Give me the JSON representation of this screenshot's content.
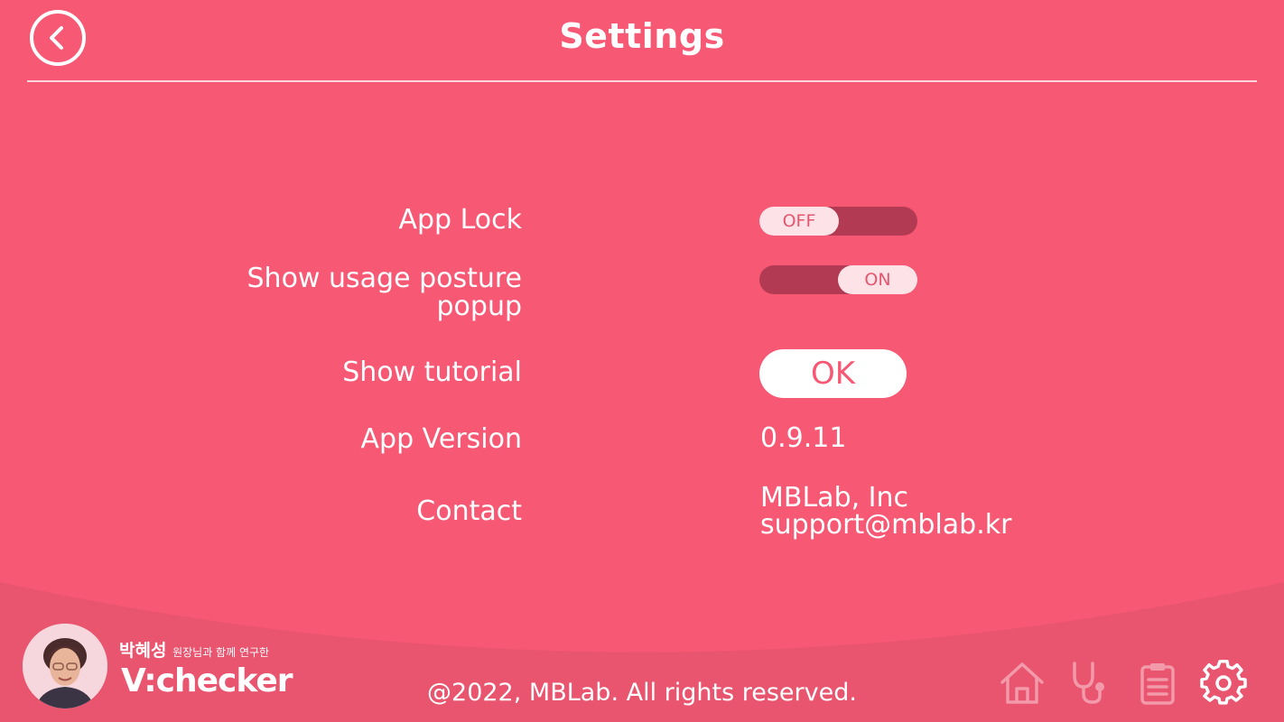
{
  "header": {
    "title": "Settings",
    "back_icon": "chevron-left-icon"
  },
  "settings": {
    "app_lock": {
      "label": "App Lock",
      "state": "OFF"
    },
    "usage_posture": {
      "label_line1": "Show usage posture",
      "label_line2": "popup",
      "state": "ON"
    },
    "tutorial": {
      "label": "Show tutorial",
      "button": "OK"
    },
    "version": {
      "label": "App Version",
      "value": "0.9.11"
    },
    "contact": {
      "label": "Contact",
      "company": "MBLab, Inc",
      "email": "support@mblab.kr"
    }
  },
  "footer": {
    "copyright": "@2022, MBLab. All rights reserved.",
    "brand_person": "박혜성",
    "brand_tagline": "원장님과 함께 연구한",
    "brand_name": "V:checker",
    "nav": [
      {
        "icon": "home-icon",
        "active": false
      },
      {
        "icon": "stethoscope-icon",
        "active": false
      },
      {
        "icon": "clipboard-icon",
        "active": false
      },
      {
        "icon": "gear-icon",
        "active": true
      }
    ]
  },
  "colors": {
    "background": "#f75874",
    "footer_band": "#e9546f",
    "toggle_track": "#b23a53",
    "toggle_knob": "#fde3e8",
    "inactive_icon": "#f39aaa"
  }
}
